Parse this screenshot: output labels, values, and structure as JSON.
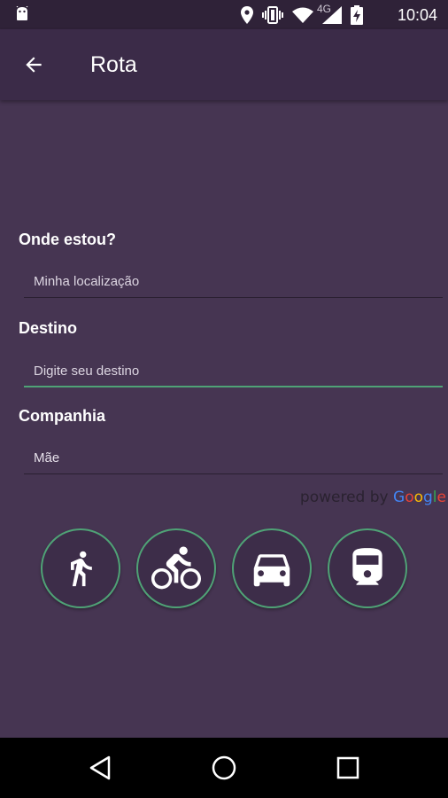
{
  "status_bar": {
    "time": "10:04",
    "network": "4G",
    "icons": [
      "android-icon",
      "location-pin-icon",
      "vibrate-icon",
      "wifi-icon",
      "signal-icon",
      "battery-charging-icon"
    ]
  },
  "app_bar": {
    "title": "Rota",
    "back_icon": "arrow-back-icon"
  },
  "form": {
    "origin": {
      "label": "Onde estou?",
      "placeholder": "Minha localização"
    },
    "destination": {
      "label": "Destino",
      "placeholder": "Digite seu destino"
    },
    "companion": {
      "label": "Companhia",
      "value": "Mãe"
    }
  },
  "attribution": {
    "prefix": "powered by",
    "brand_letters": [
      "G",
      "o",
      "o",
      "g",
      "l",
      "e"
    ]
  },
  "transport_modes": [
    {
      "name": "walk",
      "icon": "walk-icon"
    },
    {
      "name": "bike",
      "icon": "bike-icon"
    },
    {
      "name": "car",
      "icon": "car-icon"
    },
    {
      "name": "transit",
      "icon": "train-icon"
    }
  ],
  "colors": {
    "background": "#463552",
    "app_bar": "#3b2b48",
    "status_bar": "#2f2238",
    "accent": "#4fa276"
  },
  "nav_bar": {
    "icons": [
      "back-triangle-icon",
      "home-circle-icon",
      "recents-square-icon"
    ]
  }
}
